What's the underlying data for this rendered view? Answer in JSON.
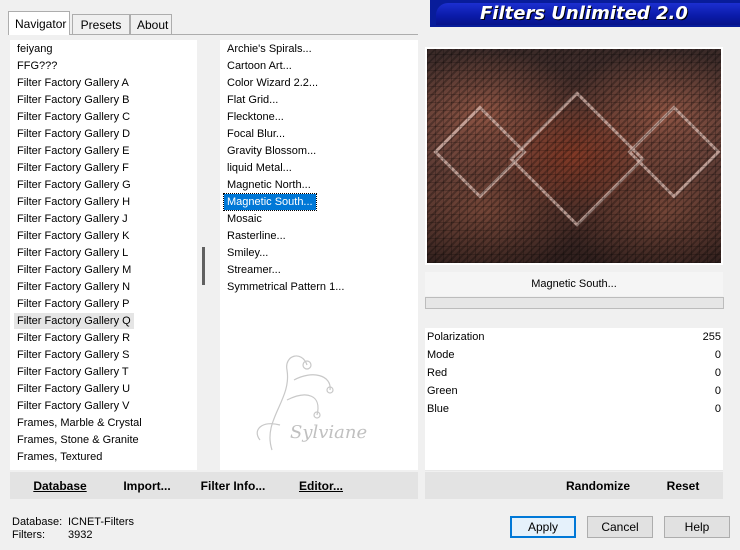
{
  "banner": {
    "title": "Filters Unlimited 2.0"
  },
  "tabs": [
    {
      "label": "Navigator",
      "active": true
    },
    {
      "label": "Presets",
      "active": false
    },
    {
      "label": "About",
      "active": false
    }
  ],
  "categories": {
    "items": [
      "feiyang",
      "FFG???",
      "Filter Factory Gallery A",
      "Filter Factory Gallery B",
      "Filter Factory Gallery C",
      "Filter Factory Gallery D",
      "Filter Factory Gallery E",
      "Filter Factory Gallery F",
      "Filter Factory Gallery G",
      "Filter Factory Gallery H",
      "Filter Factory Gallery J",
      "Filter Factory Gallery K",
      "Filter Factory Gallery L",
      "Filter Factory Gallery M",
      "Filter Factory Gallery N",
      "Filter Factory Gallery P",
      "Filter Factory Gallery Q",
      "Filter Factory Gallery R",
      "Filter Factory Gallery S",
      "Filter Factory Gallery T",
      "Filter Factory Gallery U",
      "Filter Factory Gallery V",
      "Frames, Marble & Crystal",
      "Frames, Stone & Granite",
      "Frames, Textured"
    ],
    "selected": "Filter Factory Gallery Q"
  },
  "filters": {
    "items": [
      "Archie's Spirals...",
      "Cartoon Art...",
      "Color Wizard 2.2...",
      "Flat Grid...",
      "Flecktone...",
      "Focal Blur...",
      "Gravity Blossom...",
      "liquid Metal...",
      "Magnetic North...",
      "Magnetic South...",
      "Mosaic",
      "Rasterline...",
      "Smiley...",
      "Streamer...",
      "Symmetrical Pattern 1..."
    ],
    "selected": "Magnetic South..."
  },
  "watermark": {
    "text": "Sylviane"
  },
  "preview": {
    "filter_name": "Magnetic South..."
  },
  "params": [
    {
      "label": "Polarization",
      "value": "255"
    },
    {
      "label": "Mode",
      "value": "0"
    },
    {
      "label": "Red",
      "value": "0"
    },
    {
      "label": "Green",
      "value": "0"
    },
    {
      "label": "Blue",
      "value": "0"
    }
  ],
  "toolbar": {
    "database": "Database",
    "import": "Import...",
    "filter_info": "Filter Info...",
    "editor": "Editor...",
    "randomize": "Randomize",
    "reset": "Reset"
  },
  "status": {
    "database_label": "Database:",
    "database_value": "ICNET-Filters",
    "filters_label": "Filters:",
    "filters_value": "3932"
  },
  "dialog": {
    "apply": "Apply",
    "cancel": "Cancel",
    "help": "Help"
  },
  "colors": {
    "banner": "#0a1aa8",
    "selection": "#0078d7"
  }
}
